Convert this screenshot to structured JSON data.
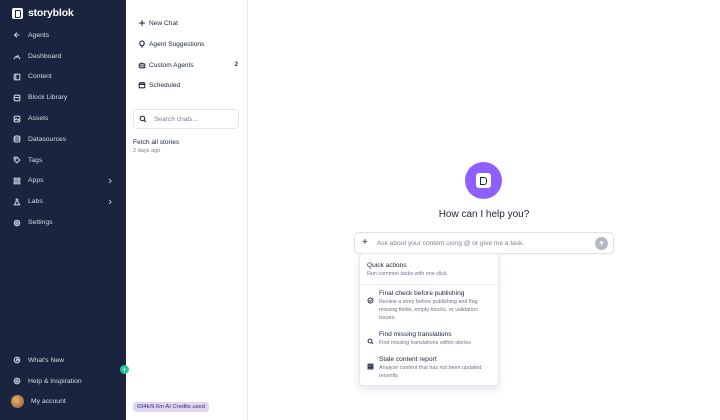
{
  "brand": {
    "name": "storyblok"
  },
  "sidebar": {
    "items": [
      {
        "label": "Agents",
        "icon": "arrow-left-icon",
        "name": "sidebar-item-agents"
      },
      {
        "label": "Dashboard",
        "icon": "dashboard-icon",
        "name": "sidebar-item-dashboard"
      },
      {
        "label": "Content",
        "icon": "content-icon",
        "name": "sidebar-item-content"
      },
      {
        "label": "Block Library",
        "icon": "block-library-icon",
        "name": "sidebar-item-block-library"
      },
      {
        "label": "Assets",
        "icon": "assets-icon",
        "name": "sidebar-item-assets"
      },
      {
        "label": "Datasources",
        "icon": "database-icon",
        "name": "sidebar-item-datasources"
      },
      {
        "label": "Tags",
        "icon": "tag-icon",
        "name": "sidebar-item-tags"
      },
      {
        "label": "Apps",
        "icon": "apps-icon",
        "name": "sidebar-item-apps"
      },
      {
        "label": "Labs",
        "icon": "labs-icon",
        "name": "sidebar-item-labs"
      },
      {
        "label": "Settings",
        "icon": "gear-icon",
        "name": "sidebar-item-settings"
      }
    ],
    "bottom": [
      {
        "label": "What's New",
        "icon": "whats-new-icon"
      },
      {
        "label": "Help & Inspiration",
        "icon": "help-icon"
      },
      {
        "label": "My account",
        "icon": "avatar"
      }
    ]
  },
  "chat_panel": {
    "new_chat": "New Chat",
    "agent_suggestions": "Agent Suggestions",
    "custom_agents": "Custom Agents",
    "custom_agents_count": "2",
    "scheduled": "Scheduled",
    "search_placeholder": "Search chats...",
    "chats": [
      {
        "title": "Fetch all stories",
        "time": "2 days ago"
      }
    ],
    "credits": "694k/9.6m AI Credits used"
  },
  "main": {
    "heading": "How can I help you?",
    "prompt_placeholder": "Ask about your content using @ or give me a task.",
    "dropdown": {
      "title": "Quick actions",
      "subtitle": "Run common tasks with one click.",
      "items": [
        {
          "title": "Final check before publishing",
          "desc": "Review a story before publishing and flag missing fields, empty blocks, or validation issues.",
          "icon": "check-circle-icon"
        },
        {
          "title": "Find missing translations",
          "desc": "Find missing translations within stories",
          "icon": "search-icon"
        },
        {
          "title": "Stale content report",
          "desc": "Analyze content that has not been updated recently.",
          "icon": "grid-icon"
        }
      ]
    }
  },
  "colors": {
    "sidebar_bg": "#1b243f",
    "accent": "#8d60ff",
    "credits_bg": "#e1d5f4",
    "collapse": "#27c49a"
  }
}
